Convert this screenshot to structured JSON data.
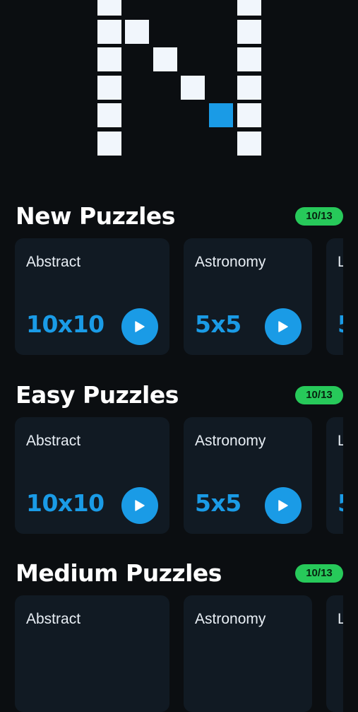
{
  "logo": {
    "icon": "nonogram-n-logo-icon",
    "colors": {
      "pixel": "#f1f6fc",
      "accent": "#1a9be6"
    }
  },
  "sections": [
    {
      "title": "New Puzzles",
      "progress": "10/13",
      "cards": [
        {
          "name": "Abstract",
          "size": "10x10"
        },
        {
          "name": "Astronomy",
          "size": "5x5"
        },
        {
          "name": "L",
          "size": "5"
        }
      ]
    },
    {
      "title": "Easy Puzzles",
      "progress": "10/13",
      "cards": [
        {
          "name": "Abstract",
          "size": "10x10"
        },
        {
          "name": "Astronomy",
          "size": "5x5"
        },
        {
          "name": "L",
          "size": "5"
        }
      ]
    },
    {
      "title": "Medium Puzzles",
      "progress": "10/13",
      "cards": [
        {
          "name": "Abstract",
          "size": ""
        },
        {
          "name": "Astronomy",
          "size": ""
        },
        {
          "name": "L",
          "size": ""
        }
      ]
    }
  ],
  "colors": {
    "background": "#0b0e11",
    "card": "#111a23",
    "accent": "#1a9be6",
    "badge": "#27c95a"
  },
  "icons": {
    "play": "play-icon"
  }
}
